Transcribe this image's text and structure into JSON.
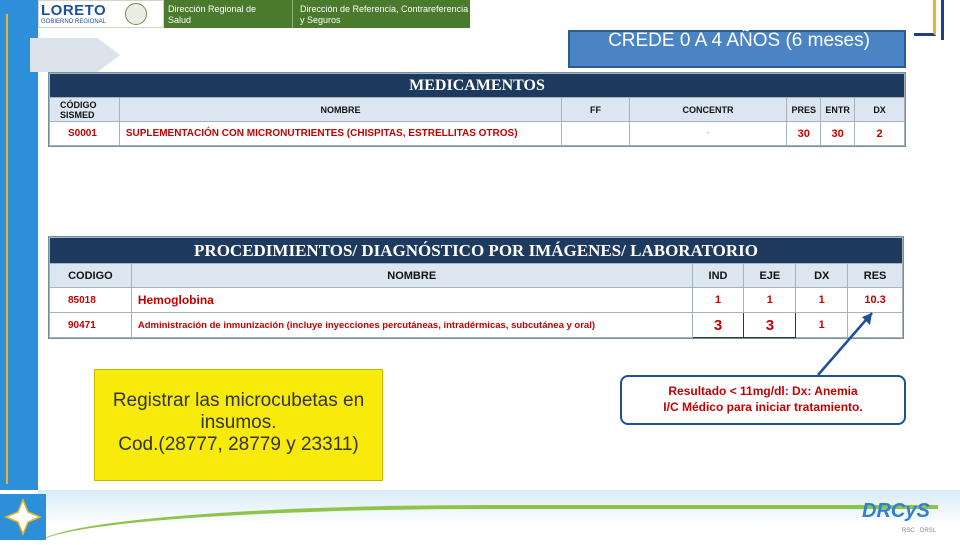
{
  "header": {
    "logo_text": "LORETO",
    "logo_sub": "GOBIERNO REGIONAL",
    "dept1": "Dirección Regional de Salud",
    "dept2": "Dirección de Referencia, Contrareferencia y Seguros"
  },
  "title": "CREDE 0 A 4 AÑOS (6 meses)",
  "medicamentos": {
    "heading": "MEDICAMENTOS",
    "columns": [
      "CÓDIGO SISMED",
      "NOMBRE",
      "FF",
      "CONCENTR",
      "PRES",
      "ENTR",
      "DX"
    ],
    "rows": [
      [
        "S0001",
        "SUPLEMENTACIÓN CON MICRONUTRIENTES (CHISPITAS, ESTRELLITAS OTROS)",
        "",
        "-",
        "30",
        "30",
        "2"
      ]
    ]
  },
  "procedimientos": {
    "heading": "PROCEDIMIENTOS/ DIAGNÓSTICO POR IMÁGENES/ LABORATORIO",
    "columns": [
      "CODIGO",
      "NOMBRE",
      "IND",
      "EJE",
      "DX",
      "RES"
    ],
    "rows": [
      [
        "85018",
        "Hemoglobina",
        "1",
        "1",
        "1",
        "10.3"
      ],
      [
        "90471",
        "Administración de inmunización (incluye inyecciones percutáneas, intradérmicas, subcutánea y oral)",
        "3",
        "3",
        "1",
        ""
      ]
    ]
  },
  "callout": {
    "line1": "Resultado < 11mg/dl: Dx: Anemia",
    "line2": "I/C Médico para iniciar tratamiento."
  },
  "note": {
    "line1": "Registrar las microcubetas en",
    "line2": "insumos.",
    "line3": "Cod.(28777, 28779 y 23311)"
  },
  "brand": {
    "name": "DRCyS",
    "sub": "RSC · DRSL"
  },
  "colors": {
    "header_green": "#4a7a2c",
    "table_head": "#1e3a5f",
    "accent_blue": "#2d8fd9",
    "alert_red": "#c40000",
    "note_yellow": "#f8ea0a"
  }
}
